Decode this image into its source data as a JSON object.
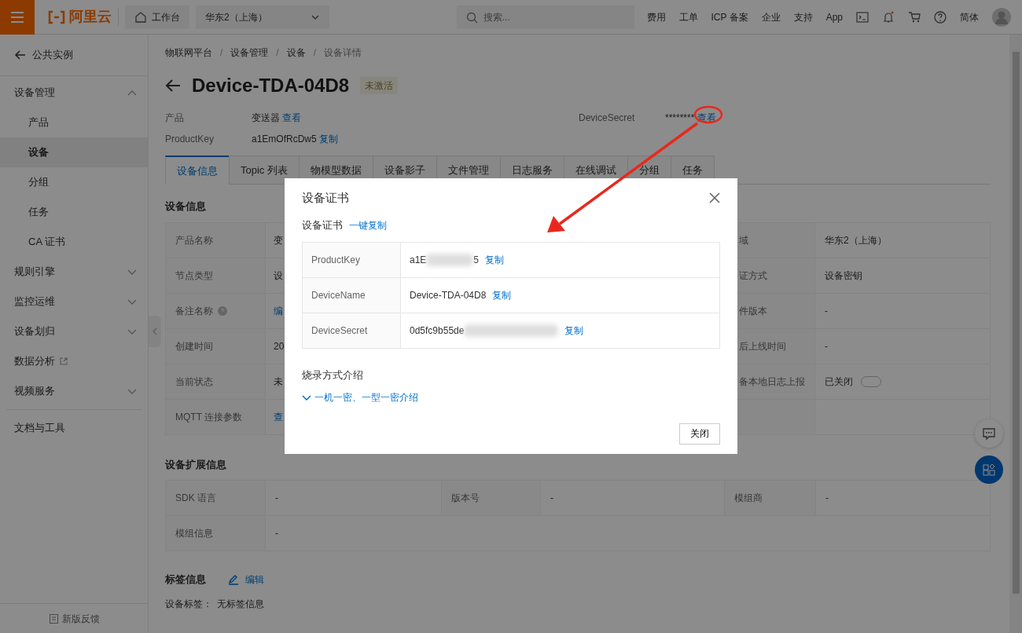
{
  "topbar": {
    "logo": "阿里云",
    "workbench": "工作台",
    "region": "华东2（上海）",
    "search": {
      "placeholder": "搜索..."
    },
    "links": [
      "费用",
      "工单",
      "ICP 备案",
      "企业",
      "支持",
      "App"
    ],
    "language": "简体"
  },
  "sidebar": {
    "back": "公共实例",
    "items": [
      {
        "label": "设备管理",
        "kind": "group",
        "expanded": true,
        "children": [
          {
            "label": "产品",
            "selected": false
          },
          {
            "label": "设备",
            "selected": true
          },
          {
            "label": "分组",
            "selected": false
          },
          {
            "label": "任务",
            "selected": false
          },
          {
            "label": "CA 证书",
            "selected": false
          }
        ]
      },
      {
        "label": "规则引擎",
        "kind": "group",
        "expanded": false
      },
      {
        "label": "监控运维",
        "kind": "group",
        "expanded": false
      },
      {
        "label": "设备划归",
        "kind": "group",
        "expanded": false
      },
      {
        "label": "数据分析",
        "kind": "external"
      },
      {
        "label": "视频服务",
        "kind": "group",
        "expanded": false
      },
      {
        "label": "文档与工具",
        "kind": "plain"
      }
    ],
    "feedback": "新版反馈"
  },
  "breadcrumb": {
    "items": [
      "物联网平台",
      "设备管理",
      "设备",
      "设备详情"
    ],
    "separators": [
      "/",
      "/",
      "/"
    ]
  },
  "device": {
    "title": "Device-TDA-04D8",
    "status": "未激活"
  },
  "meta": [
    {
      "label": "产品",
      "value": "变送器",
      "link": "查看",
      "kind": "field"
    },
    {
      "label": "DeviceSecret",
      "value": "********",
      "link": "查看",
      "kind": "secret"
    },
    {
      "label": "ProductKey",
      "value": "a1EmOfRcDw5",
      "link": "复制",
      "kind": "field"
    }
  ],
  "tabs": [
    {
      "label": "设备信息",
      "selected": true
    },
    {
      "label": "Topic 列表",
      "selected": false
    },
    {
      "label": "物模型数据",
      "selected": false
    },
    {
      "label": "设备影子",
      "selected": false
    },
    {
      "label": "文件管理",
      "selected": false
    },
    {
      "label": "日志服务",
      "selected": false
    },
    {
      "label": "在线调试",
      "selected": false
    },
    {
      "label": "分组",
      "selected": false
    },
    {
      "label": "任务",
      "selected": false
    }
  ],
  "info": {
    "title": "设备信息",
    "rows": [
      {
        "label": "产品名称",
        "value": "变",
        "kind": "text",
        "right_label": "域",
        "right_value": "华东2（上海）"
      },
      {
        "label": "节点类型",
        "value": "设",
        "kind": "text",
        "right_label": "证方式",
        "right_value": "设备密钥"
      },
      {
        "label": "备注名称",
        "help": true,
        "value": "编",
        "kind": "link",
        "right_label": "件版本",
        "right_value": "-"
      },
      {
        "label": "创建时间",
        "value": "20",
        "kind": "text",
        "right_label": "后上线时间",
        "right_value": "-"
      },
      {
        "label": "当前状态",
        "value": "未",
        "kind": "text",
        "right_label": "备本地日志上报",
        "right_value": "已关闭",
        "toggle": {
          "on": false
        }
      },
      {
        "label": "MQTT 连接参数",
        "value": "查",
        "kind": "link"
      }
    ]
  },
  "extended": {
    "title": "设备扩展信息",
    "rows": [
      {
        "cells": [
          {
            "label": "SDK 语言",
            "value": "-"
          },
          {
            "label": "版本号",
            "value": "-"
          },
          {
            "label": "模组商",
            "value": "-"
          }
        ]
      },
      {
        "cells": [
          {
            "label": "模组信息",
            "value": "-"
          }
        ]
      }
    ]
  },
  "tags": {
    "title": "标签信息",
    "edit": "编辑",
    "label": "设备标签：",
    "value": "无标签信息"
  },
  "dialog": {
    "title": "设备证书",
    "subtitle": "设备证书",
    "copy_all": "一键复制",
    "rows": [
      {
        "label": "ProductKey",
        "value_start": "a1E",
        "blurred": true,
        "value_end": "5",
        "copy": "复制"
      },
      {
        "label": "DeviceName",
        "value_start": "Device-TDA-04D8",
        "blurred": false,
        "copy": "复制"
      },
      {
        "label": "DeviceSecret",
        "value_start": "0d5fc9b55de",
        "blurred": true,
        "copy": "复制"
      }
    ],
    "section": "烧录方式介绍",
    "expander": "一机一密、一型一密介绍",
    "close": "关闭"
  }
}
